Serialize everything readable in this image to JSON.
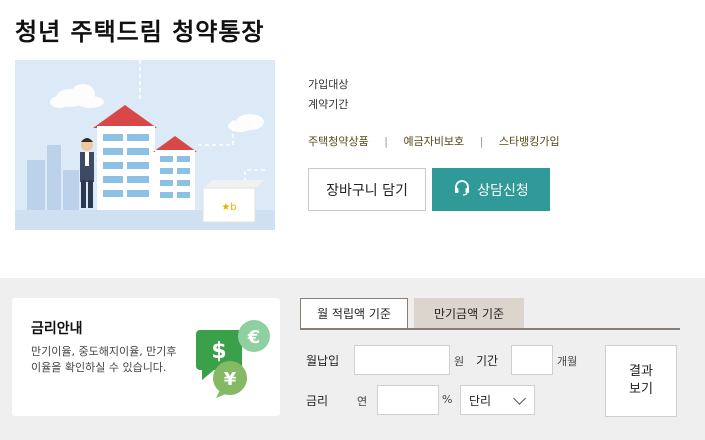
{
  "product": {
    "title": "청년 주택드림 청약통장",
    "info_labels": [
      "가입대상",
      "계약기간"
    ],
    "links": [
      "주택청약상품",
      "예금자비보호",
      "스타뱅킹가입"
    ],
    "cart_button": "장바구니 담기",
    "consult_button": "상담신청",
    "headset_icon": "headset-icon"
  },
  "rate_info": {
    "title": "금리안내",
    "description": "만기이율, 중도해지이율, 만기후 이율을 확인하실 수 있습니다."
  },
  "calculator": {
    "tabs": [
      {
        "label": "월 적립액 기준",
        "active": true
      },
      {
        "label": "만기금액 기준",
        "active": false
      }
    ],
    "monthly_label": "월납입",
    "monthly_value": "",
    "won_unit": "원",
    "period_label": "기간",
    "period_value": "",
    "month_unit": "개월",
    "rate_label": "금리",
    "year_prefix": "연",
    "rate_value": "",
    "percent_unit": "%",
    "interest_type": "단리",
    "result_button_line1": "결과",
    "result_button_line2": "보기"
  },
  "colors": {
    "accent": "#2f9a98",
    "tab_border": "#8a7e74",
    "inactive_tab": "#dcd5cd",
    "bottom_bg": "#efefef"
  }
}
